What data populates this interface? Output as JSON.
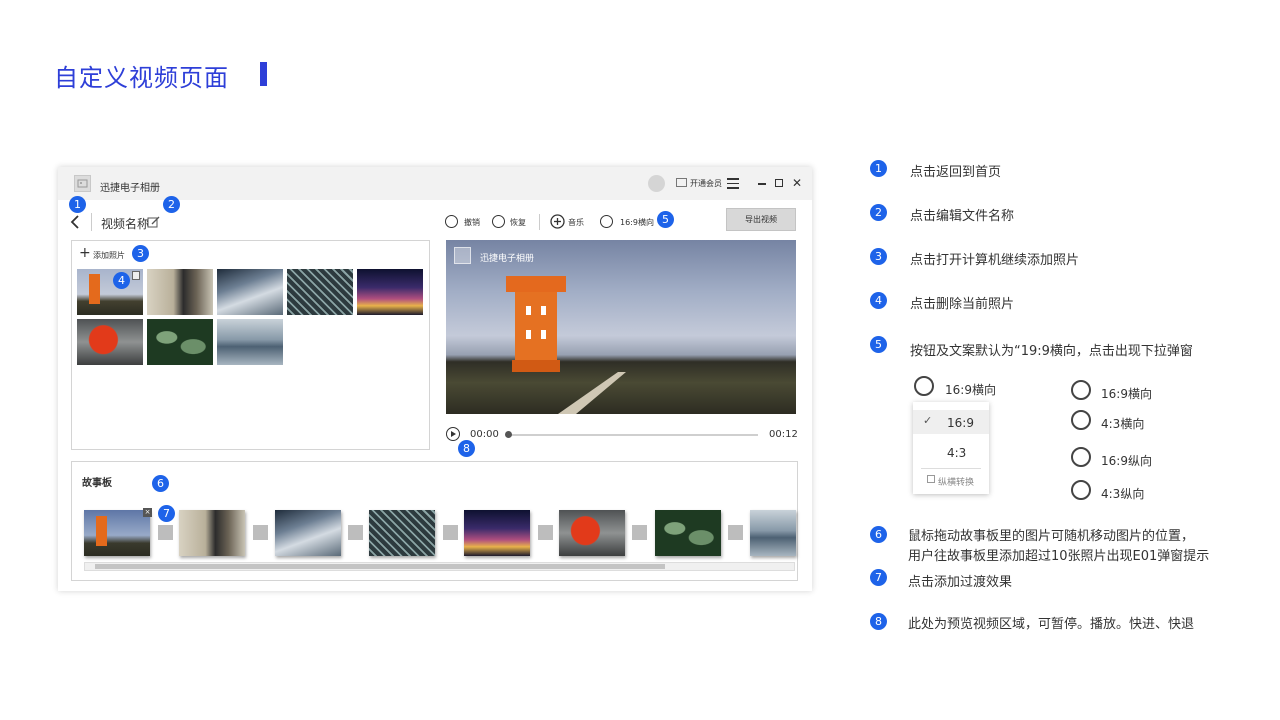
{
  "page_title": "自定义视频页面",
  "app": {
    "name": "迅捷电子相册",
    "member_label": "开通会员",
    "video_name": "视频名称",
    "add_photo": "添加照片",
    "toolbar": {
      "undo": "撤销",
      "redo": "恢复",
      "music": "音乐",
      "ratio": "16:9横向"
    },
    "export_button": "导出视频",
    "preview_logo": "迅捷电子相册",
    "time_current": "00:00",
    "time_total": "00:12",
    "storyboard_title": "故事板"
  },
  "badges": [
    "1",
    "2",
    "3",
    "4",
    "5",
    "6",
    "7",
    "8"
  ],
  "notes": [
    {
      "num": "1",
      "text": "点击返回到首页"
    },
    {
      "num": "2",
      "text": "点击编辑文件名称"
    },
    {
      "num": "3",
      "text": "点击打开计算机继续添加照片"
    },
    {
      "num": "4",
      "text": "点击删除当前照片"
    },
    {
      "num": "5",
      "text": "按钮及文案默认为“19:9横向，点击出现下拉弹窗"
    },
    {
      "num": "6",
      "text": "鼠标拖动故事板里的图片可随机移动图片的位置，",
      "text2": "用户往故事板里添加超过10张照片出现E01弹窗提示"
    },
    {
      "num": "7",
      "text": "点击添加过渡效果"
    },
    {
      "num": "8",
      "text": "此处为预览视频区域，可暂停。播放。快进、快退"
    }
  ],
  "dropdown": {
    "selected": "16:9横向",
    "options": [
      "16:9",
      "4:3"
    ],
    "toggle": "纵横转换"
  },
  "ratio_options": [
    "16:9横向",
    "4:3横向",
    "16:9纵向",
    "4:3纵向"
  ],
  "colors": {
    "accent": "#2e3fd8",
    "badge": "#1e63e9"
  }
}
